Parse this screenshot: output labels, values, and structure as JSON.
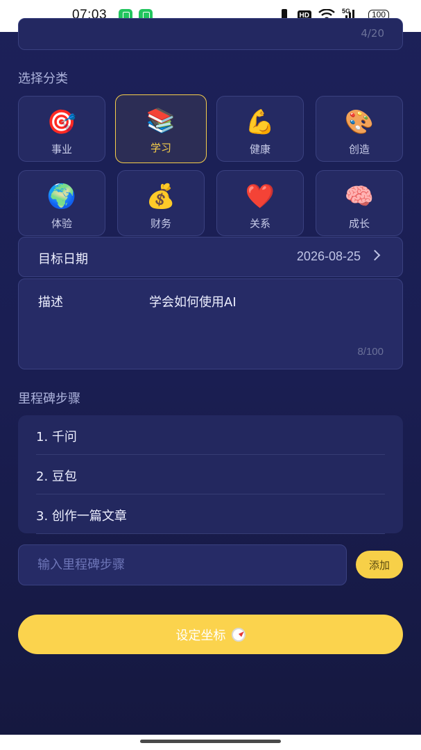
{
  "status_bar": {
    "time": "07:03",
    "hd": "HD",
    "network": "5G",
    "battery": "100"
  },
  "title_field": {
    "count": "4/20"
  },
  "category_section": {
    "label": "选择分类"
  },
  "categories": [
    {
      "emoji": "🎯",
      "label": "事业"
    },
    {
      "emoji": "📚",
      "label": "学习"
    },
    {
      "emoji": "💪",
      "label": "健康"
    },
    {
      "emoji": "🎨",
      "label": "创造"
    },
    {
      "emoji": "🌍",
      "label": "体验"
    },
    {
      "emoji": "💰",
      "label": "财务"
    },
    {
      "emoji": "❤️",
      "label": "关系"
    },
    {
      "emoji": "🧠",
      "label": "成长"
    }
  ],
  "selected_category": "学习",
  "target_date": {
    "label": "目标日期",
    "value": "2026-08-25"
  },
  "description": {
    "label": "描述",
    "text": "学会如何使用AI",
    "count": "8/100"
  },
  "milestone_section": {
    "label": "里程碑步骤"
  },
  "milestones": [
    "1. 千问",
    "2. 豆包",
    "3. 创作一篇文章"
  ],
  "milestone_input": {
    "placeholder": "输入里程碑步骤",
    "add_label": "添加"
  },
  "submit": {
    "label": "设定坐标"
  },
  "colors": {
    "accent": "#fbd34d",
    "background": "#1c2159",
    "card": "#262b66"
  }
}
